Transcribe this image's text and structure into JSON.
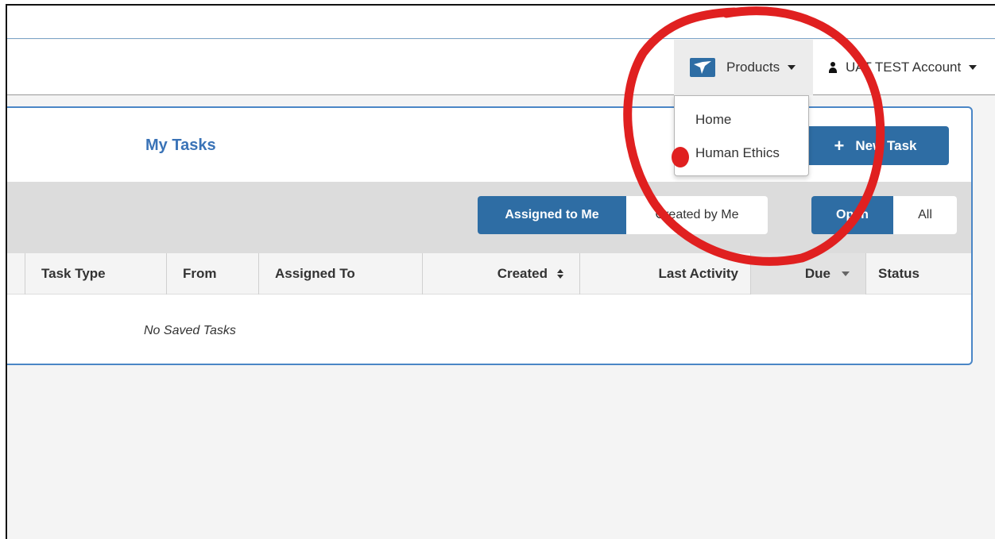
{
  "navbar": {
    "products_label": "Products",
    "account_label": "UAT TEST Account"
  },
  "products_menu": {
    "items": [
      {
        "label": "Home"
      },
      {
        "label": "Human Ethics"
      }
    ]
  },
  "panel": {
    "title": "My Tasks",
    "new_task_label": "New Task"
  },
  "filters": {
    "assignment": [
      {
        "label": "Assigned to Me",
        "active": true
      },
      {
        "label": "Created by Me",
        "active": false
      }
    ],
    "state": [
      {
        "label": "Open",
        "active": true
      },
      {
        "label": "All",
        "active": false
      }
    ]
  },
  "table": {
    "columns": [
      {
        "label": "Task Type"
      },
      {
        "label": "From"
      },
      {
        "label": "Assigned To"
      },
      {
        "label": "Created",
        "sort": "both"
      },
      {
        "label": "Last Activity"
      },
      {
        "label": "Due",
        "sort": "desc"
      },
      {
        "label": "Status"
      }
    ],
    "empty_message": "No Saved Tasks"
  },
  "colors": {
    "primary": "#2e6da4",
    "title": "#3a73b7",
    "annotation": "#e02020"
  }
}
